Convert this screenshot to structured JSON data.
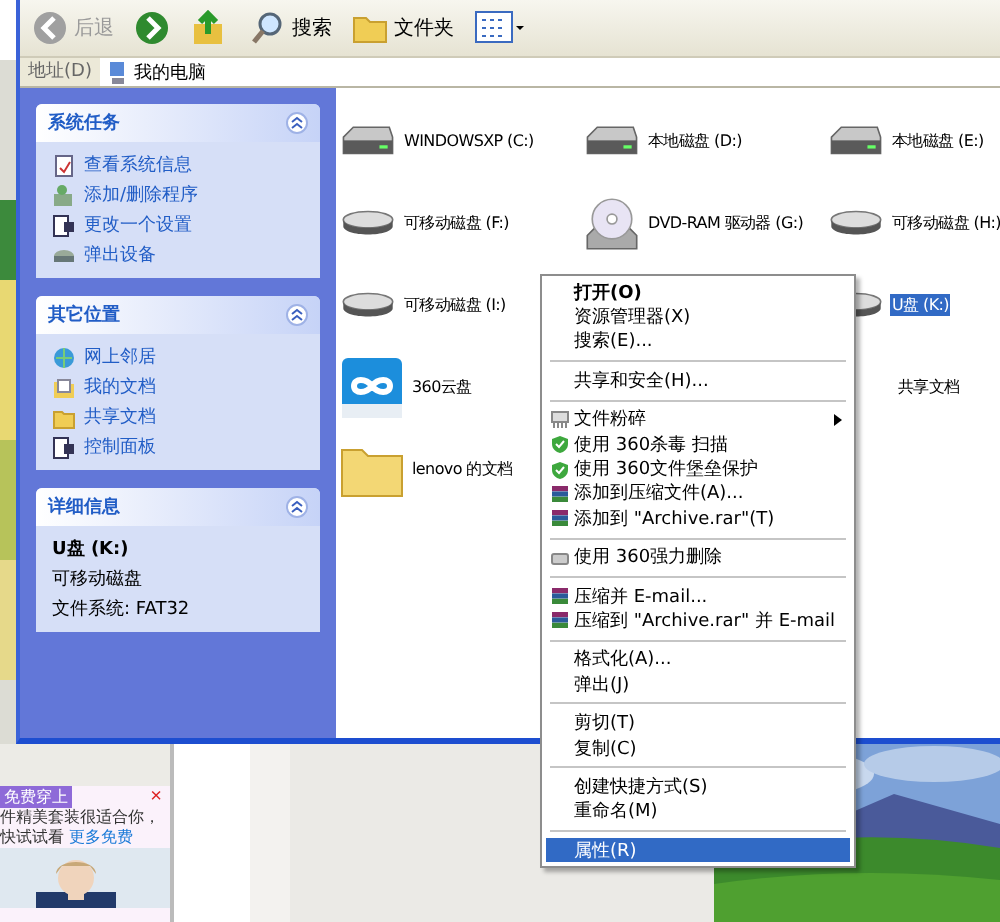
{
  "toolbar": {
    "buttons": [
      {
        "kind": "back",
        "label": "后退",
        "disabled": true
      },
      {
        "kind": "forward",
        "disabled": false
      },
      {
        "kind": "up",
        "disabled": false
      },
      {
        "kind": "search",
        "label": "搜索",
        "disabled": false
      },
      {
        "kind": "folders",
        "label": "文件夹",
        "disabled": false
      },
      {
        "kind": "views",
        "disabled": false
      }
    ]
  },
  "address_bar": {
    "label": "地址(D)",
    "value": "我的电脑"
  },
  "sidebar": {
    "sections": [
      {
        "title": "系统任务",
        "expanded": true,
        "items": [
          {
            "kind": "info",
            "label": "查看系统信息"
          },
          {
            "kind": "programs",
            "label": "添加/删除程序"
          },
          {
            "kind": "settings",
            "label": "更改一个设置"
          },
          {
            "kind": "eject",
            "label": "弹出设备"
          }
        ]
      },
      {
        "title": "其它位置",
        "expanded": true,
        "items": [
          {
            "kind": "network",
            "label": "网上邻居"
          },
          {
            "kind": "documents",
            "label": "我的文档"
          },
          {
            "kind": "folder",
            "label": "共享文档"
          },
          {
            "kind": "settings",
            "label": "控制面板"
          }
        ]
      },
      {
        "title": "详细信息",
        "expanded": true,
        "details": [
          "U盘 (K:)",
          "可移动磁盘",
          "文件系统: FAT32"
        ]
      }
    ]
  },
  "icon_columns": [
    [
      {
        "kind": "harddisk",
        "label": "WINDOWSXP (C:)",
        "selected": false
      },
      {
        "kind": "removable",
        "label": "可移动磁盘 (F:)",
        "selected": false
      },
      {
        "kind": "removable",
        "label": "可移动磁盘 (I:)",
        "selected": false
      },
      {
        "kind": "cloud",
        "label": "360云盘",
        "selected": false
      },
      {
        "kind": "folder",
        "label": "lenovo 的文档",
        "selected": false
      }
    ],
    [
      {
        "kind": "harddisk",
        "label": "本地磁盘 (D:)",
        "selected": false
      },
      {
        "kind": "dvd",
        "label": "DVD-RAM 驱动器 (G:)",
        "selected": false
      }
    ],
    [
      {
        "kind": "harddisk",
        "label": "本地磁盘 (E:)",
        "selected": false
      },
      {
        "kind": "removable",
        "label": "可移动磁盘 (H:)",
        "selected": false
      },
      {
        "kind": "removable",
        "label": "U盘 (K:)",
        "selected": true
      },
      {
        "kind": "hidden",
        "label": "共享文档",
        "selected": false
      }
    ]
  ],
  "context_menu": {
    "groups": [
      [
        {
          "kind": "plain",
          "label": "打开(O)",
          "bold": true,
          "submenu": false,
          "selected": false
        },
        {
          "kind": "plain",
          "label": "资源管理器(X)",
          "bold": false,
          "submenu": false,
          "selected": false
        },
        {
          "kind": "plain",
          "label": "搜索(E)...",
          "bold": false,
          "submenu": false,
          "selected": false
        }
      ],
      [
        {
          "kind": "plain",
          "label": "共享和安全(H)...",
          "bold": false,
          "submenu": false,
          "selected": false
        }
      ],
      [
        {
          "kind": "shredder",
          "label": "文件粉碎",
          "bold": false,
          "submenu": true,
          "selected": false
        },
        {
          "kind": "shield",
          "label": "使用 360杀毒 扫描",
          "bold": false,
          "submenu": false,
          "selected": false
        },
        {
          "kind": "shield",
          "label": "使用 360文件堡垒保护",
          "bold": false,
          "submenu": false,
          "selected": false
        },
        {
          "kind": "archive",
          "label": "添加到压缩文件(A)...",
          "bold": false,
          "submenu": false,
          "selected": false
        },
        {
          "kind": "archive",
          "label": "添加到 \"Archive.rar\"(T)",
          "bold": false,
          "submenu": false,
          "selected": false
        }
      ],
      [
        {
          "kind": "eraser",
          "label": "使用 360强力删除",
          "bold": false,
          "submenu": false,
          "selected": false
        }
      ],
      [
        {
          "kind": "archive",
          "label": "压缩并 E-mail...",
          "bold": false,
          "submenu": false,
          "selected": false
        },
        {
          "kind": "archive",
          "label": "压缩到 \"Archive.rar\" 并 E-mail",
          "bold": false,
          "submenu": false,
          "selected": false
        }
      ],
      [
        {
          "kind": "plain",
          "label": "格式化(A)...",
          "bold": false,
          "submenu": false,
          "selected": false
        },
        {
          "kind": "plain",
          "label": "弹出(J)",
          "bold": false,
          "submenu": false,
          "selected": false
        }
      ],
      [
        {
          "kind": "plain",
          "label": "剪切(T)",
          "bold": false,
          "submenu": false,
          "selected": false
        },
        {
          "kind": "plain",
          "label": "复制(C)",
          "bold": false,
          "submenu": false,
          "selected": false
        }
      ],
      [
        {
          "kind": "plain",
          "label": "创建快捷方式(S)",
          "bold": false,
          "submenu": false,
          "selected": false
        },
        {
          "kind": "plain",
          "label": "重命名(M)",
          "bold": false,
          "submenu": false,
          "selected": false
        }
      ],
      [
        {
          "kind": "plain",
          "label": "属性(R)",
          "bold": false,
          "submenu": false,
          "selected": true
        }
      ]
    ]
  },
  "ad": {
    "tag": "免费穿上",
    "text": "件精美套装很适合你，快试试看",
    "link": "更多免费",
    "close": "×"
  }
}
